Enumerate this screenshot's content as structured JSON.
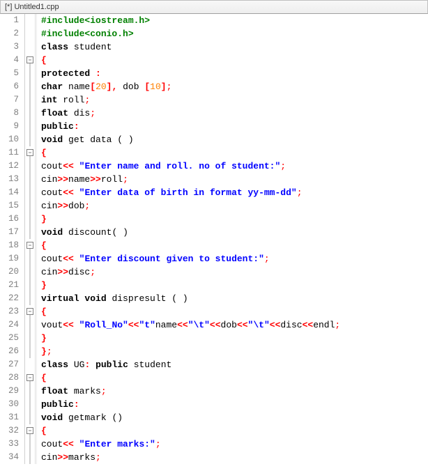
{
  "title": "[*] Untitled1.cpp",
  "syntax": {
    "keywords": [
      "class",
      "protected",
      "char",
      "int",
      "float",
      "public",
      "void",
      "virtual"
    ],
    "preproc_prefix": "#"
  },
  "lines": [
    {
      "n": 1,
      "fold": "none",
      "raw": "#include<iostream.h>"
    },
    {
      "n": 2,
      "fold": "none",
      "raw": "#include<conio.h>"
    },
    {
      "n": 3,
      "fold": "none",
      "raw": "class student"
    },
    {
      "n": 4,
      "fold": "open",
      "raw": "{"
    },
    {
      "n": 5,
      "fold": "line",
      "raw": "protected :"
    },
    {
      "n": 6,
      "fold": "line",
      "raw": "char name[20], dob [10];"
    },
    {
      "n": 7,
      "fold": "line",
      "raw": "int roll;"
    },
    {
      "n": 8,
      "fold": "line",
      "raw": "float dis;"
    },
    {
      "n": 9,
      "fold": "line",
      "raw": "public:"
    },
    {
      "n": 10,
      "fold": "line",
      "raw": "void get data ( )"
    },
    {
      "n": 11,
      "fold": "open",
      "raw": "{"
    },
    {
      "n": 12,
      "fold": "line",
      "raw": "cout<< \"Enter name and roll. no of student:\";"
    },
    {
      "n": 13,
      "fold": "line",
      "raw": "cin>>name>>roll;"
    },
    {
      "n": 14,
      "fold": "line",
      "raw": "cout<< \"Enter data of birth in format yy-mm-dd\";"
    },
    {
      "n": 15,
      "fold": "line",
      "raw": "cin>>dob;"
    },
    {
      "n": 16,
      "fold": "line",
      "raw": "}"
    },
    {
      "n": 17,
      "fold": "line",
      "raw": "void discount( )"
    },
    {
      "n": 18,
      "fold": "open",
      "raw": "{"
    },
    {
      "n": 19,
      "fold": "line",
      "raw": "cout<< \"Enter discount given to student:\";"
    },
    {
      "n": 20,
      "fold": "line",
      "raw": "cin>>disc;"
    },
    {
      "n": 21,
      "fold": "line",
      "raw": "}"
    },
    {
      "n": 22,
      "fold": "line",
      "raw": "virtual void dispresult ( )"
    },
    {
      "n": 23,
      "fold": "open",
      "raw": "{"
    },
    {
      "n": 24,
      "fold": "line",
      "raw": "vout<< \"Roll_No\"<<\"t\"name<<\"\\t\"<<dob<<\"\\t\"<<disc<<endl;"
    },
    {
      "n": 25,
      "fold": "line",
      "raw": "}"
    },
    {
      "n": 26,
      "fold": "line",
      "raw": "};"
    },
    {
      "n": 27,
      "fold": "none",
      "raw": "class UG: public student"
    },
    {
      "n": 28,
      "fold": "open",
      "raw": "{"
    },
    {
      "n": 29,
      "fold": "line",
      "raw": "float marks;"
    },
    {
      "n": 30,
      "fold": "line",
      "raw": "public:"
    },
    {
      "n": 31,
      "fold": "line",
      "raw": "void getmark ()"
    },
    {
      "n": 32,
      "fold": "open",
      "raw": "{"
    },
    {
      "n": 33,
      "fold": "line",
      "raw": "cout<< \"Enter marks:\";"
    },
    {
      "n": 34,
      "fold": "line",
      "raw": "cin>>marks;"
    }
  ]
}
